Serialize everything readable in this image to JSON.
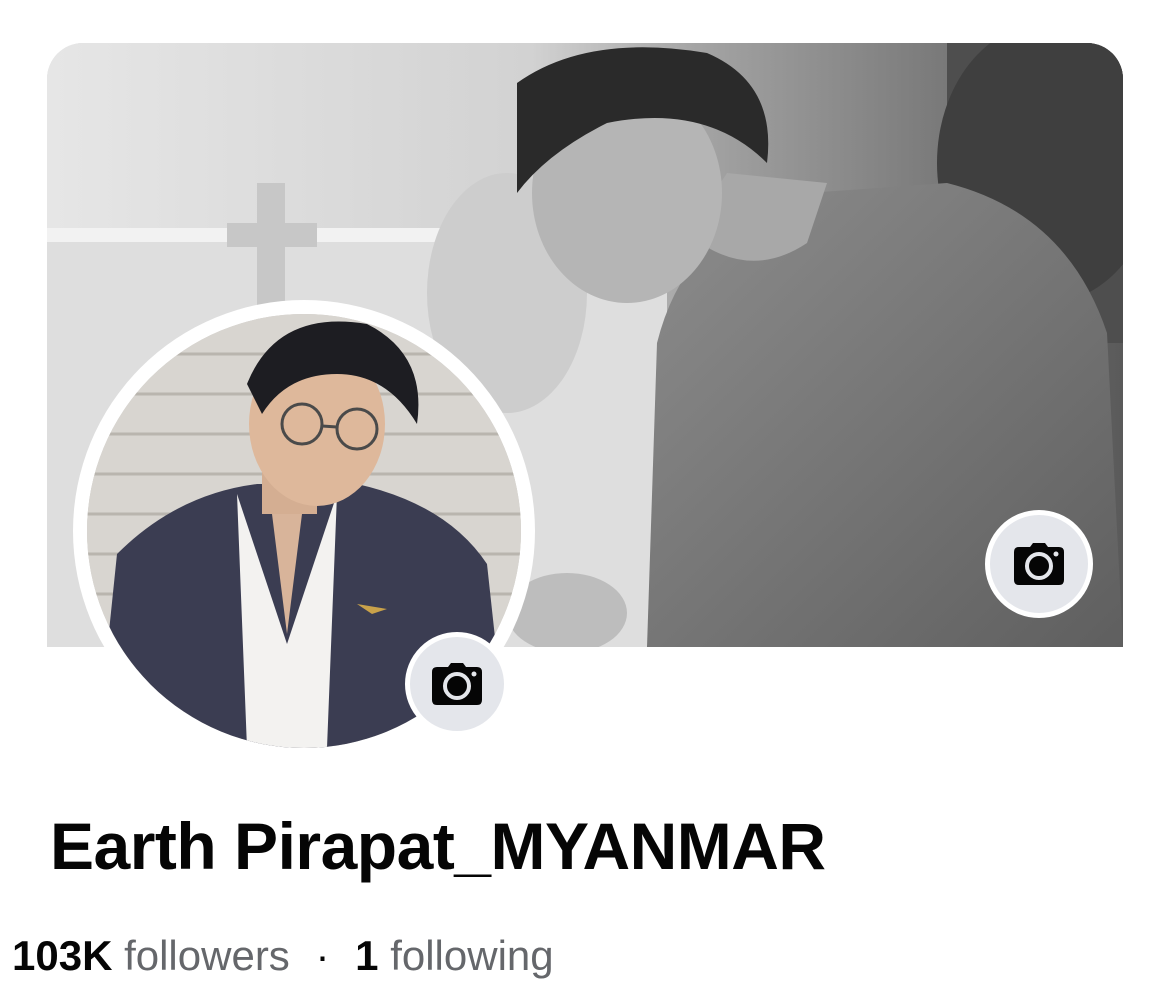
{
  "profile": {
    "name": "Earth Pirapat_MYANMAR",
    "followers_count": "103K",
    "followers_label": "followers",
    "separator": "·",
    "following_count": "1",
    "following_label": "following"
  },
  "icons": {
    "cover_camera": "camera-icon",
    "profile_camera": "camera-icon"
  },
  "colors": {
    "camera_button_bg": "#e4e6eb",
    "name_text": "#050505",
    "secondary_text": "#65676b"
  }
}
